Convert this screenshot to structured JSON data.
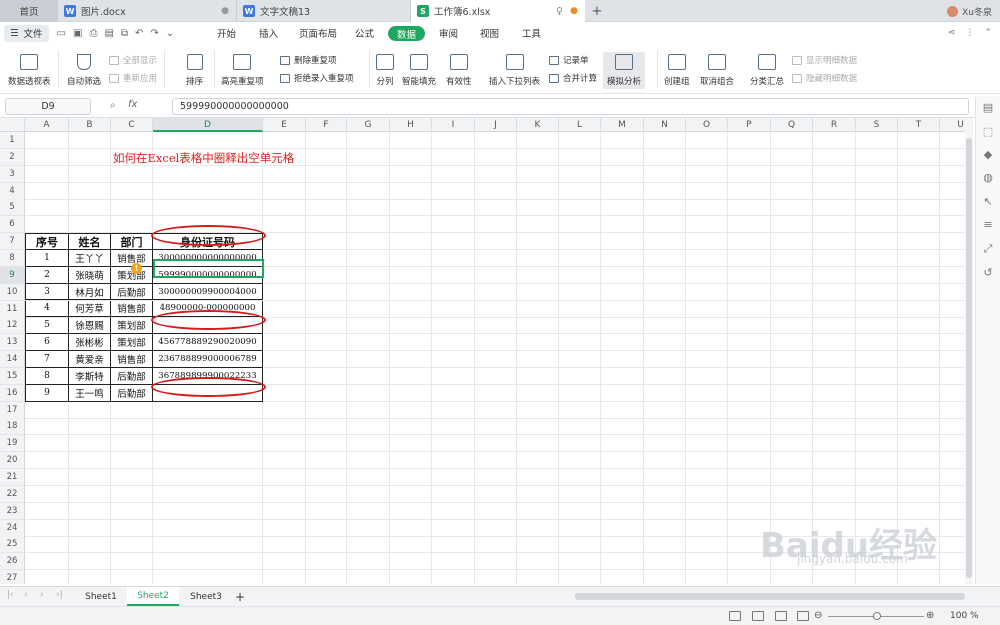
{
  "tabs": {
    "home": "首页",
    "doc1": "图片.docx",
    "doc2": "文字文稿13",
    "sheet": "工作簿6.xlsx",
    "user": "Xu冬泉"
  },
  "menubar": {
    "file": "文件",
    "items": [
      "开始",
      "插入",
      "页面布局",
      "公式",
      "数据",
      "审阅",
      "视图",
      "工具"
    ],
    "active": "数据"
  },
  "ribbon": {
    "pivot": "数据透视表",
    "autofilter": "自动筛选",
    "show_all": "全部显示",
    "reapply": "重新应用",
    "sort": "排序",
    "highlight_dup": "高亮重复项",
    "delete_dup": "删除重复项",
    "reject_dup": "拒绝录入重复项",
    "split": "分列",
    "smart_fill": "智能填充",
    "validity": "有效性",
    "insert_dropdown": "插入下拉列表",
    "record": "记录单",
    "merge_calc": "合并计算",
    "simulate": "模拟分析",
    "create_group": "创建组",
    "ungroup": "取消组合",
    "subtotal": "分类汇总",
    "show_detail": "显示明细数据",
    "hide_detail": "隐藏明细数据"
  },
  "formula_bar": {
    "name_box": "D9",
    "fx": "fx",
    "value": "599990000000000000"
  },
  "columns": [
    "A",
    "B",
    "C",
    "D",
    "E",
    "F",
    "G",
    "H",
    "I",
    "J",
    "K",
    "L",
    "M",
    "N",
    "O",
    "P",
    "Q",
    "R",
    "S",
    "T",
    "U"
  ],
  "rows": [
    "1",
    "2",
    "3",
    "4",
    "5",
    "6",
    "7",
    "8",
    "9",
    "10",
    "11",
    "12",
    "13",
    "14",
    "15",
    "16",
    "17",
    "18",
    "19",
    "20",
    "21",
    "22",
    "23",
    "24",
    "25",
    "26",
    "27",
    "28",
    "29"
  ],
  "title": "如何在Excel表格中圈释出空单元格",
  "table": {
    "headers": [
      "序号",
      "姓名",
      "部门",
      "身份证号码"
    ],
    "rows": [
      [
        "1",
        "王丫丫",
        "销售部",
        "300000000000000000"
      ],
      [
        "2",
        "张晓萌",
        "策划部",
        "599990000000000000"
      ],
      [
        "3",
        "林月如",
        "后勤部",
        "300000009900004000"
      ],
      [
        "4",
        "何芳草",
        "销售部",
        "48900000-000000000"
      ],
      [
        "5",
        "徐恩赐",
        "策划部",
        ""
      ],
      [
        "6",
        "张彬彬",
        "策划部",
        "456778889290020090"
      ],
      [
        "7",
        "黄爱亲",
        "销售部",
        "236788899000006789"
      ],
      [
        "8",
        "李斯特",
        "后勤部",
        "367889899900022233"
      ],
      [
        "9",
        "王一鸣",
        "后勤部",
        ""
      ]
    ]
  },
  "sheets": [
    "Sheet1",
    "Sheet2",
    "Sheet3"
  ],
  "active_sheet": "Sheet2",
  "zoom": "100 %",
  "watermark": {
    "brand": "Baidu经验",
    "url": "jingyan.baidu.com"
  },
  "colors": {
    "accent": "#1ea760",
    "circle": "#d41a1a",
    "title": "#e02020"
  }
}
